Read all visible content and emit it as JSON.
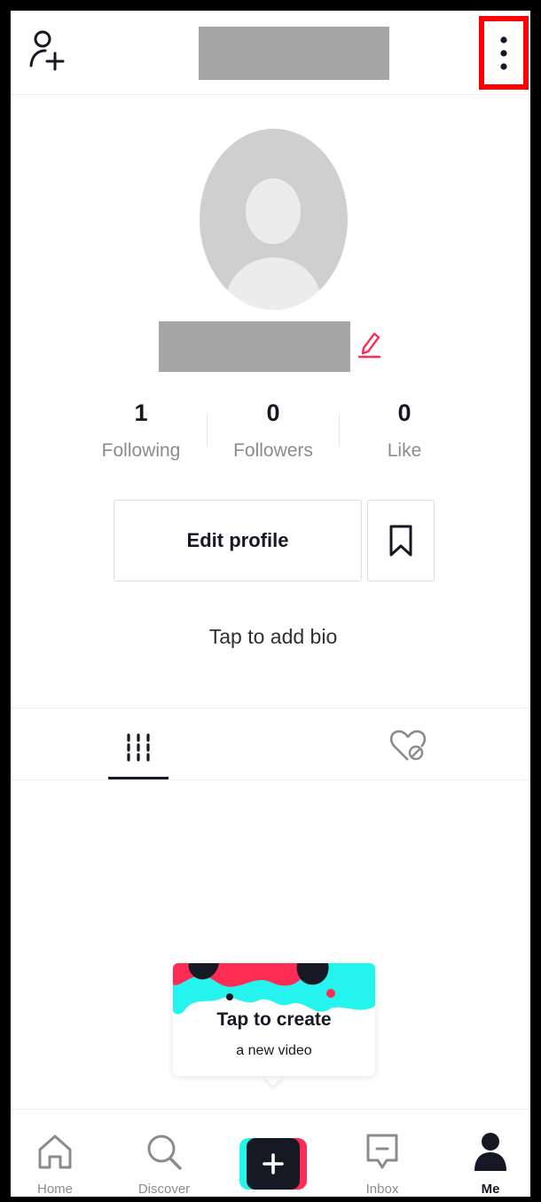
{
  "header": {
    "add_friend_icon": "person-plus-icon",
    "more_icon": "vertical-ellipsis-icon",
    "highlight_color": "#ff0000"
  },
  "profile": {
    "avatar_icon": "default-avatar",
    "edit_icon": "pencil-icon",
    "edit_icon_color": "#fe2c55",
    "stats": [
      {
        "value": "1",
        "label": "Following"
      },
      {
        "value": "0",
        "label": "Followers"
      },
      {
        "value": "0",
        "label": "Like"
      }
    ],
    "edit_profile_label": "Edit profile",
    "bookmark_icon": "bookmark-icon",
    "bio_prompt": "Tap to add bio"
  },
  "tabs": [
    {
      "icon": "videos-grid-icon",
      "active": true
    },
    {
      "icon": "liked-hidden-icon",
      "active": false
    }
  ],
  "create_tooltip": {
    "title": "Tap to create",
    "subtitle": "a new video"
  },
  "bottom_nav": {
    "items": [
      {
        "label": "Home",
        "icon": "home-icon"
      },
      {
        "label": "Discover",
        "icon": "search-icon"
      },
      {
        "label": "",
        "icon": "plus-icon"
      },
      {
        "label": "Inbox",
        "icon": "inbox-icon"
      },
      {
        "label": "Me",
        "icon": "person-icon",
        "active": true
      }
    ]
  },
  "colors": {
    "accent_pink": "#fe2c55",
    "accent_cyan": "#25f4ee",
    "text_dark": "#161823",
    "text_muted": "#8a8b91"
  }
}
